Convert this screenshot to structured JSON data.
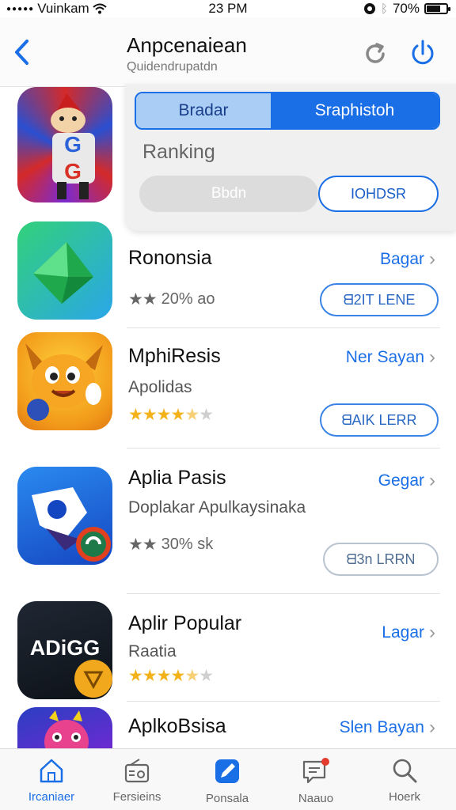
{
  "status_bar": {
    "carrier": "Vuinkam",
    "time": "23 PM",
    "battery": "70%",
    "battery_level": 0.7
  },
  "header": {
    "title": "Anpcenaiean",
    "subtitle": "Quidendrupatdn"
  },
  "filter_popover": {
    "segments": [
      "Bradar",
      "Sraphistoh"
    ],
    "selected_segment": "Sraphistoh",
    "label": "Ranking",
    "pill_left": "Bbdn",
    "pill_right": "IOHDSR"
  },
  "apps": [
    {
      "name": "Rononsia",
      "subtitle": "",
      "stars": 2,
      "stars_style": "gray",
      "rating_text": "20% ao",
      "get_label": "Bagar",
      "button_label": "ᗺ2IT LENE"
    },
    {
      "name": "MphiResis",
      "subtitle": "Apolidas",
      "stars": 4.5,
      "stars_style": "gold",
      "rating_text": "",
      "get_label": "Ner Sayan",
      "button_label": "ᗺAIK LERR"
    },
    {
      "name": "Aplia Pasis",
      "subtitle": "Doplakar Apulkaysinaka",
      "stars": 2,
      "stars_style": "gray",
      "rating_text": "30% sk",
      "get_label": "Gegar",
      "button_label": "ᗺ3n LRRN"
    },
    {
      "name": "Aplir Popular",
      "subtitle": "Raatia",
      "stars": 4.5,
      "stars_style": "gold",
      "rating_text": "",
      "get_label": "Lagar",
      "button_label": "",
      "icon_text": "ADiGG"
    },
    {
      "name": "AplkoBsisa",
      "subtitle": "",
      "stars": 0,
      "stars_style": "gold",
      "rating_text": "",
      "get_label": "Slen Bayan",
      "button_label": ""
    }
  ],
  "tabbar": {
    "tabs": [
      {
        "label": "Ircaniaer",
        "icon": "home-icon",
        "active": true
      },
      {
        "label": "Fersieins",
        "icon": "radio-icon",
        "active": false
      },
      {
        "label": "Ponsala",
        "icon": "edit-icon",
        "active": false
      },
      {
        "label": "Naauo",
        "icon": "message-icon",
        "active": false
      },
      {
        "label": "Hoerk",
        "icon": "search-icon",
        "active": false
      }
    ]
  },
  "colors": {
    "accent": "#1a6ee6",
    "star": "#f3b21a"
  }
}
